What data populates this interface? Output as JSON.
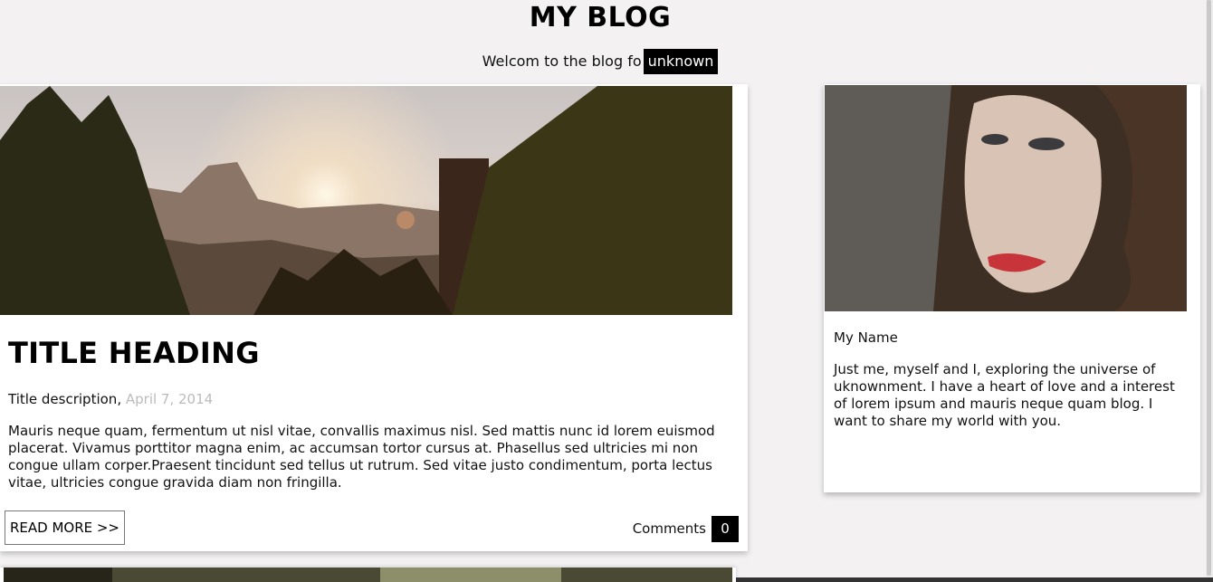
{
  "header": {
    "title": "MY BLOG",
    "welcome_text": "Welcom to the blog fo",
    "welcome_tag": "unknown"
  },
  "post": {
    "title": "TITLE HEADING",
    "description": "Title description,",
    "date": "April 7, 2014",
    "body": "Mauris neque quam, fermentum ut nisl vitae, convallis maximus nisl. Sed mattis nunc id lorem euismod placerat. Vivamus porttitor magna enim, ac accumsan tortor cursus at. Phasellus sed ultricies mi non congue ullam corper.Praesent tincidunt sed tellus ut rutrum. Sed vitae justo condimentum, porta lectus vitae, ultricies congue gravida diam non fringilla.",
    "read_more_label": "READ MORE >>",
    "comments_label": "Comments",
    "comments_count": "0"
  },
  "profile": {
    "name": "My Name",
    "bio": "Just me, myself and I, exploring the universe of uknownment. I have a heart of love and a interest of lorem ipsum and mauris neque quam blog. I want to share my world with you."
  },
  "colors": {
    "page_bg": "#f3f1f2",
    "card_bg": "#ffffff",
    "accent_dark": "#000000",
    "date_text": "#bbbbbb"
  }
}
